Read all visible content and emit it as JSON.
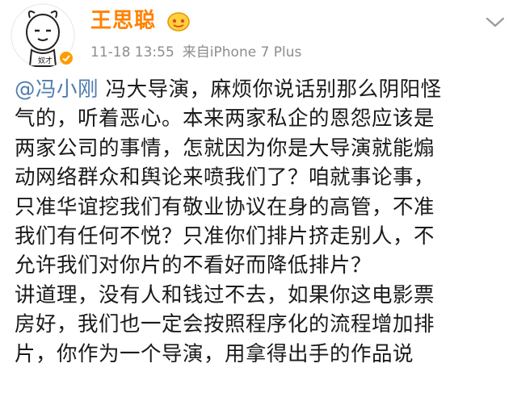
{
  "post": {
    "username": "王思聪",
    "timestamp": "11-18 13:55",
    "source": "来自iPhone 7 Plus",
    "avatar_caption": "奴才"
  },
  "content": {
    "mention": "@冯小刚",
    "lines": [
      " 冯大导演，麻烦你说话别那么阴阳怪",
      "气的，听着恶心。本来两家私企的恩怨应该是",
      "两家公司的事情，怎就因为你是大导演就能煽",
      "动网络群众和舆论来喷我们了？咱就事论事，",
      "只准华谊挖我们有敬业协议在身的高管，不准",
      "我们有任何不悦？只准你们排片挤走别人，不",
      "允许我们对你片的不看好而降低排片？",
      "讲道理，没有人和钱过不去，如果你这电影票",
      "房好，我们也一定会按照程序化的流程增加排",
      "片，你作为一个导演，用拿得出手的作品说"
    ]
  },
  "icons": {
    "avatar": "cartoon-face-avatar",
    "badge": "verified-badge-icon",
    "vip": "vip-crown-icon",
    "chevron": "chevron-down-icon"
  },
  "colors": {
    "username": "#ff8200",
    "mention": "#507daf",
    "meta": "#8d8d8d",
    "text": "#1a1a1a"
  }
}
